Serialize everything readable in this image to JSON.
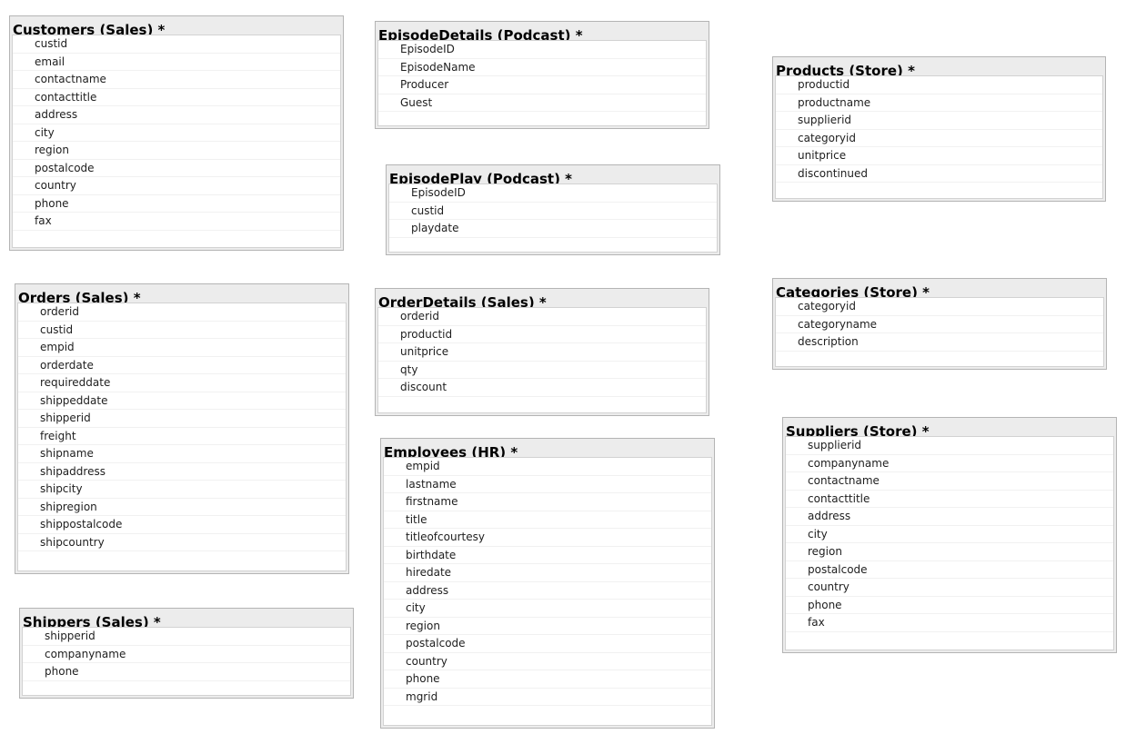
{
  "tables": {
    "customers": {
      "title": "Customers (Sales) *",
      "columns": [
        "custid",
        "email",
        "contactname",
        "contacttitle",
        "address",
        "city",
        "region",
        "postalcode",
        "country",
        "phone",
        "fax"
      ]
    },
    "episodedetails": {
      "title": "EpisodeDetails (Podcast) *",
      "columns": [
        "EpisodeID",
        "EpisodeName",
        "Producer",
        "Guest"
      ]
    },
    "products": {
      "title": "Products (Store) *",
      "columns": [
        "productid",
        "productname",
        "supplierid",
        "categoryid",
        "unitprice",
        "discontinued"
      ]
    },
    "episodeplay": {
      "title": "EpisodePlay (Podcast) *",
      "columns": [
        "EpisodeID",
        "custid",
        "playdate"
      ]
    },
    "orders": {
      "title": "Orders (Sales) *",
      "columns": [
        "orderid",
        "custid",
        "empid",
        "orderdate",
        "requireddate",
        "shippeddate",
        "shipperid",
        "freight",
        "shipname",
        "shipaddress",
        "shipcity",
        "shipregion",
        "shippostalcode",
        "shipcountry"
      ]
    },
    "orderdetails": {
      "title": "OrderDetails (Sales) *",
      "columns": [
        "orderid",
        "productid",
        "unitprice",
        "qty",
        "discount"
      ]
    },
    "categories": {
      "title": "Categories (Store) *",
      "columns": [
        "categoryid",
        "categoryname",
        "description"
      ]
    },
    "suppliers": {
      "title": "Suppliers (Store) *",
      "columns": [
        "supplierid",
        "companyname",
        "contactname",
        "contacttitle",
        "address",
        "city",
        "region",
        "postalcode",
        "country",
        "phone",
        "fax"
      ]
    },
    "employees": {
      "title": "Employees (HR) *",
      "columns": [
        "empid",
        "lastname",
        "firstname",
        "title",
        "titleofcourtesy",
        "birthdate",
        "hiredate",
        "address",
        "city",
        "region",
        "postalcode",
        "country",
        "phone",
        "mgrid"
      ]
    },
    "shippers": {
      "title": "Shippers (Sales) *",
      "columns": [
        "shipperid",
        "companyname",
        "phone"
      ]
    }
  }
}
